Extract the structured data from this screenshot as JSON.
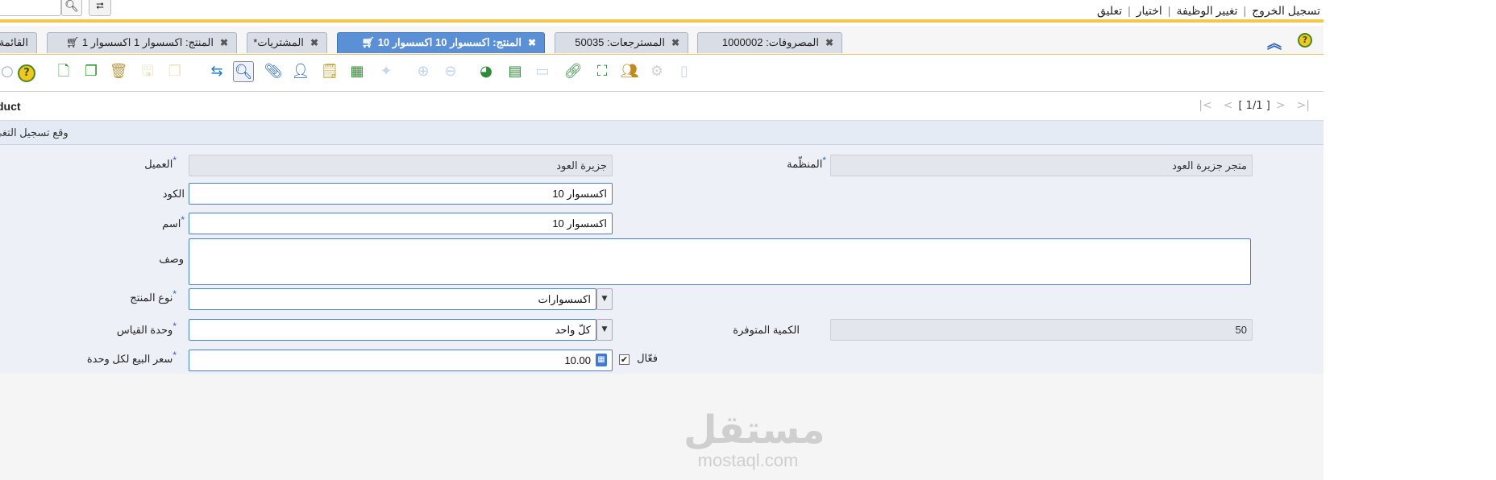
{
  "top_menu": {
    "items": [
      "تسجيل الخروج",
      "تغيير الوظيفة",
      "اختيار",
      "تعليق"
    ]
  },
  "tabs": [
    {
      "label": "المصروفات: 1000002",
      "active": false
    },
    {
      "label": "المسترجعات: 50035",
      "active": false
    },
    {
      "label": "المنتج: اكسسوار 10 اكسسوار 10",
      "active": true
    },
    {
      "label": "المشتريات*",
      "active": false
    },
    {
      "label": "المنتج: اكسسوار 1 اكسسوار 1",
      "active": false
    },
    {
      "label": "القائمة",
      "active": false
    }
  ],
  "window": {
    "title": "duct",
    "pager": "[ 1/1 ]",
    "breadcrumb": "وقع تسجيل التغي"
  },
  "form": {
    "client_label": "العميل",
    "client_value": "جزيرة العود",
    "org_label": "المنظّمة",
    "org_value": "متجر جزيرة العود",
    "code_label": "الكود",
    "code_value": "اكسسوار 10",
    "name_label": "اسم",
    "name_value": "اكسسوار 10",
    "desc_label": "وصف",
    "desc_value": "",
    "type_label": "نوع المنتج",
    "type_value": "اكسسوارات",
    "uom_label": "وحدة القياس",
    "uom_value": "كلّ واحد",
    "qty_label": "الكمية المتوفرة",
    "qty_value": "50",
    "price_label": "سعر البيع لكل وحدة",
    "price_value": "10.00",
    "active_label": "فعّال",
    "active_checked": "✔"
  },
  "watermark": {
    "arabic": "مستقل",
    "latin": "mostaql.com"
  }
}
